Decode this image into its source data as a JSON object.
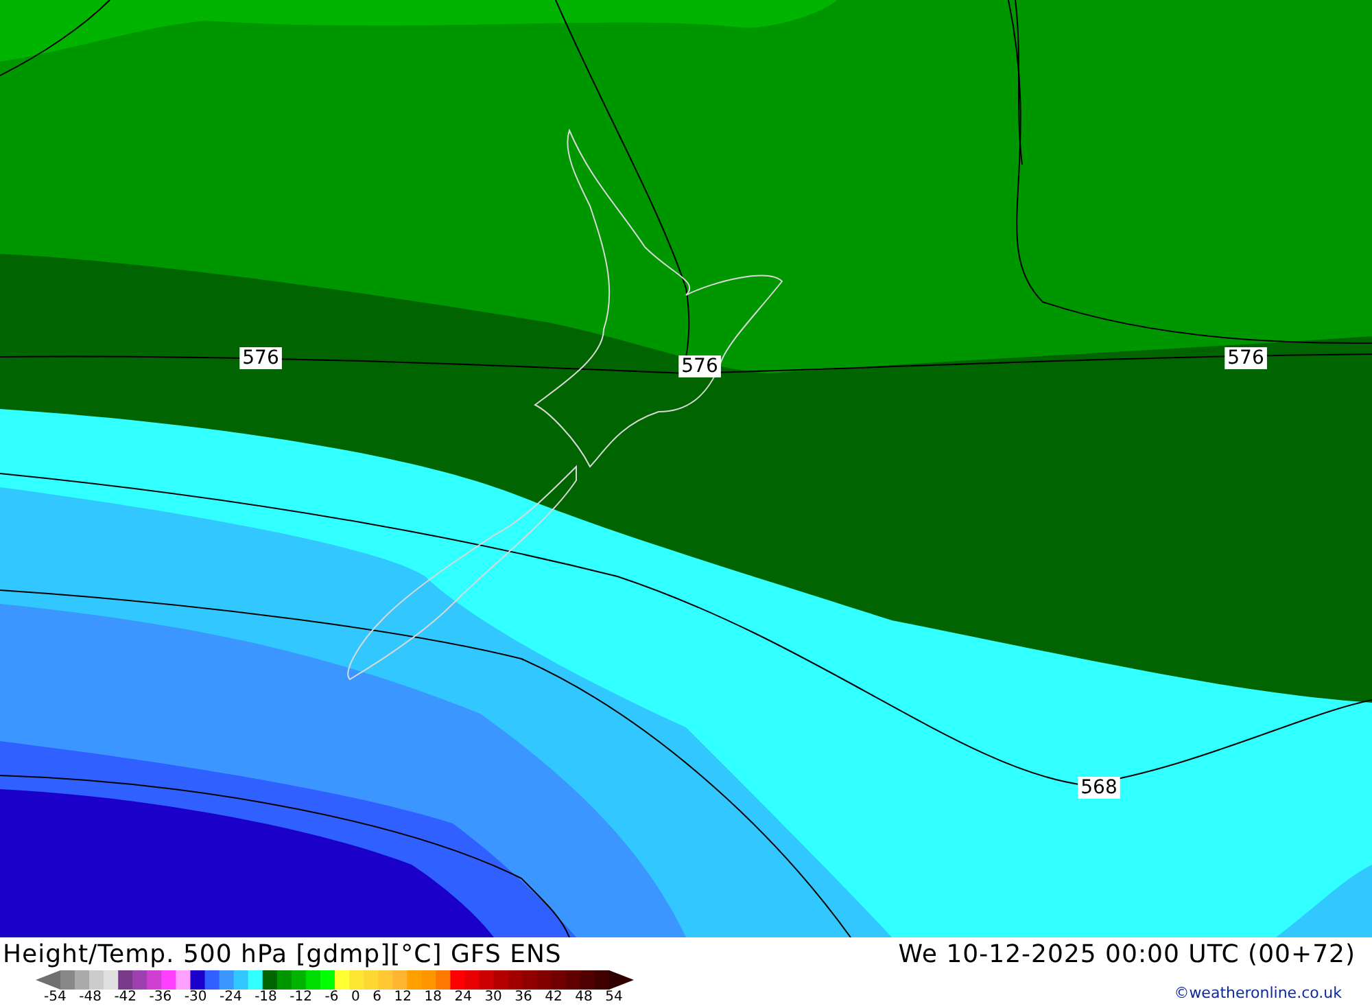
{
  "map": {
    "contour_labels": [
      "576",
      "576",
      "576",
      "568"
    ]
  },
  "footer": {
    "title": "Height/Temp. 500 hPa [gdmp][°C] GFS ENS",
    "valid_time": "We 10-12-2025 00:00 UTC (00+72)",
    "copyright": "©weatheronline.co.uk",
    "colorbar": {
      "swatches": [
        {
          "color": "#888888"
        },
        {
          "color": "#aaaaaa"
        },
        {
          "color": "#cccccc"
        },
        {
          "color": "#e0e0e0"
        },
        {
          "color": "#7a3a8a"
        },
        {
          "color": "#a040b0"
        },
        {
          "color": "#d040d0"
        },
        {
          "color": "#ff40ff"
        },
        {
          "color": "#ffa0ff"
        },
        {
          "color": "#1a00c8"
        },
        {
          "color": "#3060ff"
        },
        {
          "color": "#3c96ff"
        },
        {
          "color": "#32c8ff"
        },
        {
          "color": "#32ffff"
        },
        {
          "color": "#006400"
        },
        {
          "color": "#009600"
        },
        {
          "color": "#00b400"
        },
        {
          "color": "#00dc00"
        },
        {
          "color": "#00ff00"
        },
        {
          "color": "#ffff32"
        },
        {
          "color": "#ffe632"
        },
        {
          "color": "#ffd732"
        },
        {
          "color": "#ffc832"
        },
        {
          "color": "#ffb432"
        },
        {
          "color": "#ffa000"
        },
        {
          "color": "#ff9600"
        },
        {
          "color": "#ff7800"
        },
        {
          "color": "#ff0000"
        },
        {
          "color": "#e60000"
        },
        {
          "color": "#cc0000"
        },
        {
          "color": "#b40000"
        },
        {
          "color": "#a00000"
        },
        {
          "color": "#900000"
        },
        {
          "color": "#800000"
        },
        {
          "color": "#700000"
        },
        {
          "color": "#600000"
        },
        {
          "color": "#500000"
        },
        {
          "color": "#400000"
        }
      ],
      "ticks": [
        "-54",
        "-48",
        "-42",
        "-36",
        "-30",
        "-24",
        "-18",
        "-12",
        "-6",
        "0",
        "6",
        "12",
        "18",
        "24",
        "30",
        "36",
        "42",
        "48",
        "54"
      ]
    }
  }
}
